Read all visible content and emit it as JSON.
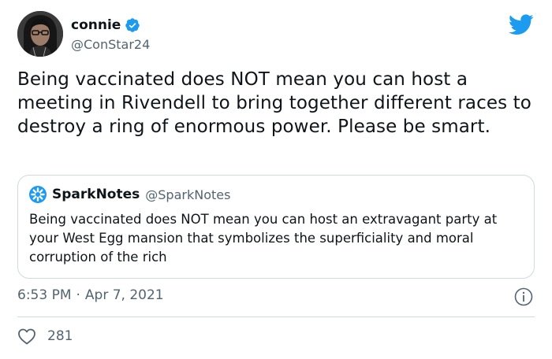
{
  "author": {
    "display_name": "connie",
    "handle": "@ConStar24"
  },
  "tweet": {
    "text": "Being vaccinated does NOT mean you can host a meeting in Rivendell to bring together different races to destroy a ring of enormous power. Please be smart."
  },
  "quoted_tweet": {
    "display_name": "SparkNotes",
    "handle": "@SparkNotes",
    "text": "Being vaccinated does NOT mean you can host an extravagant party at your West Egg mansion that symbolizes the superficiality and moral corruption of the rich"
  },
  "meta": {
    "time": "6:53 PM",
    "separator": "·",
    "date": "Apr 7, 2021"
  },
  "stats": {
    "likes": "281"
  },
  "colors": {
    "twitter_blue": "#1d9bf0",
    "secondary_text": "#536471",
    "border": "#cfd9de"
  },
  "icons": {
    "verified": "verified-badge-icon",
    "bird": "twitter-bird-icon",
    "sparknotes_logo": "sparknotes-logo-icon",
    "info": "info-icon",
    "like": "heart-icon"
  }
}
